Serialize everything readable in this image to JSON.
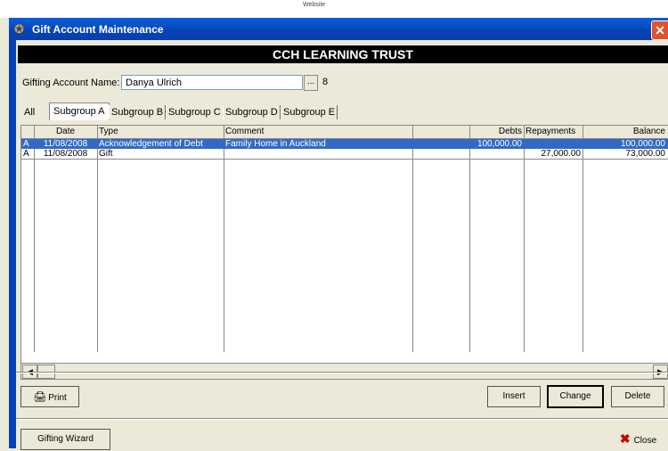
{
  "background_toolbar": {
    "items": [
      "Website"
    ]
  },
  "window": {
    "title": "Gift Account Maintenance"
  },
  "banner": {
    "text": "CCH LEARNING TRUST"
  },
  "account": {
    "label": "Gifting Account Name:",
    "value": "Danya Ulrich",
    "browse_label": "...",
    "number": "8"
  },
  "tabs": [
    {
      "label": "All"
    },
    {
      "label": "Subgroup A"
    },
    {
      "label": "Subgroup B"
    },
    {
      "label": "Subgroup C"
    },
    {
      "label": "Subgroup D"
    },
    {
      "label": "Subgroup E"
    }
  ],
  "table": {
    "columns": [
      "",
      "Date",
      "Type",
      "Comment",
      "",
      "Debts",
      "Repayments",
      "Balance"
    ],
    "rows": [
      {
        "flag": "A",
        "date": "11/08/2008",
        "type": "Acknowledgement of Debt",
        "comment": "Family Home in Auckland",
        "extra": "",
        "debts": "100,000.00",
        "repayments": "",
        "balance": "100,000.00",
        "selected": true
      },
      {
        "flag": "A",
        "date": "11/08/2008",
        "type": "Gift",
        "comment": "",
        "extra": "",
        "debts": "",
        "repayments": "27,000.00",
        "balance": "73,000.00",
        "selected": false
      }
    ]
  },
  "buttons": {
    "print": "Print",
    "insert": "Insert",
    "change": "Change",
    "delete": "Delete",
    "wizard": "Gifting Wizard",
    "close": "Close"
  },
  "colors": {
    "title_bar": "#0543b5",
    "selection": "#316ac5",
    "banner": "#000000"
  }
}
